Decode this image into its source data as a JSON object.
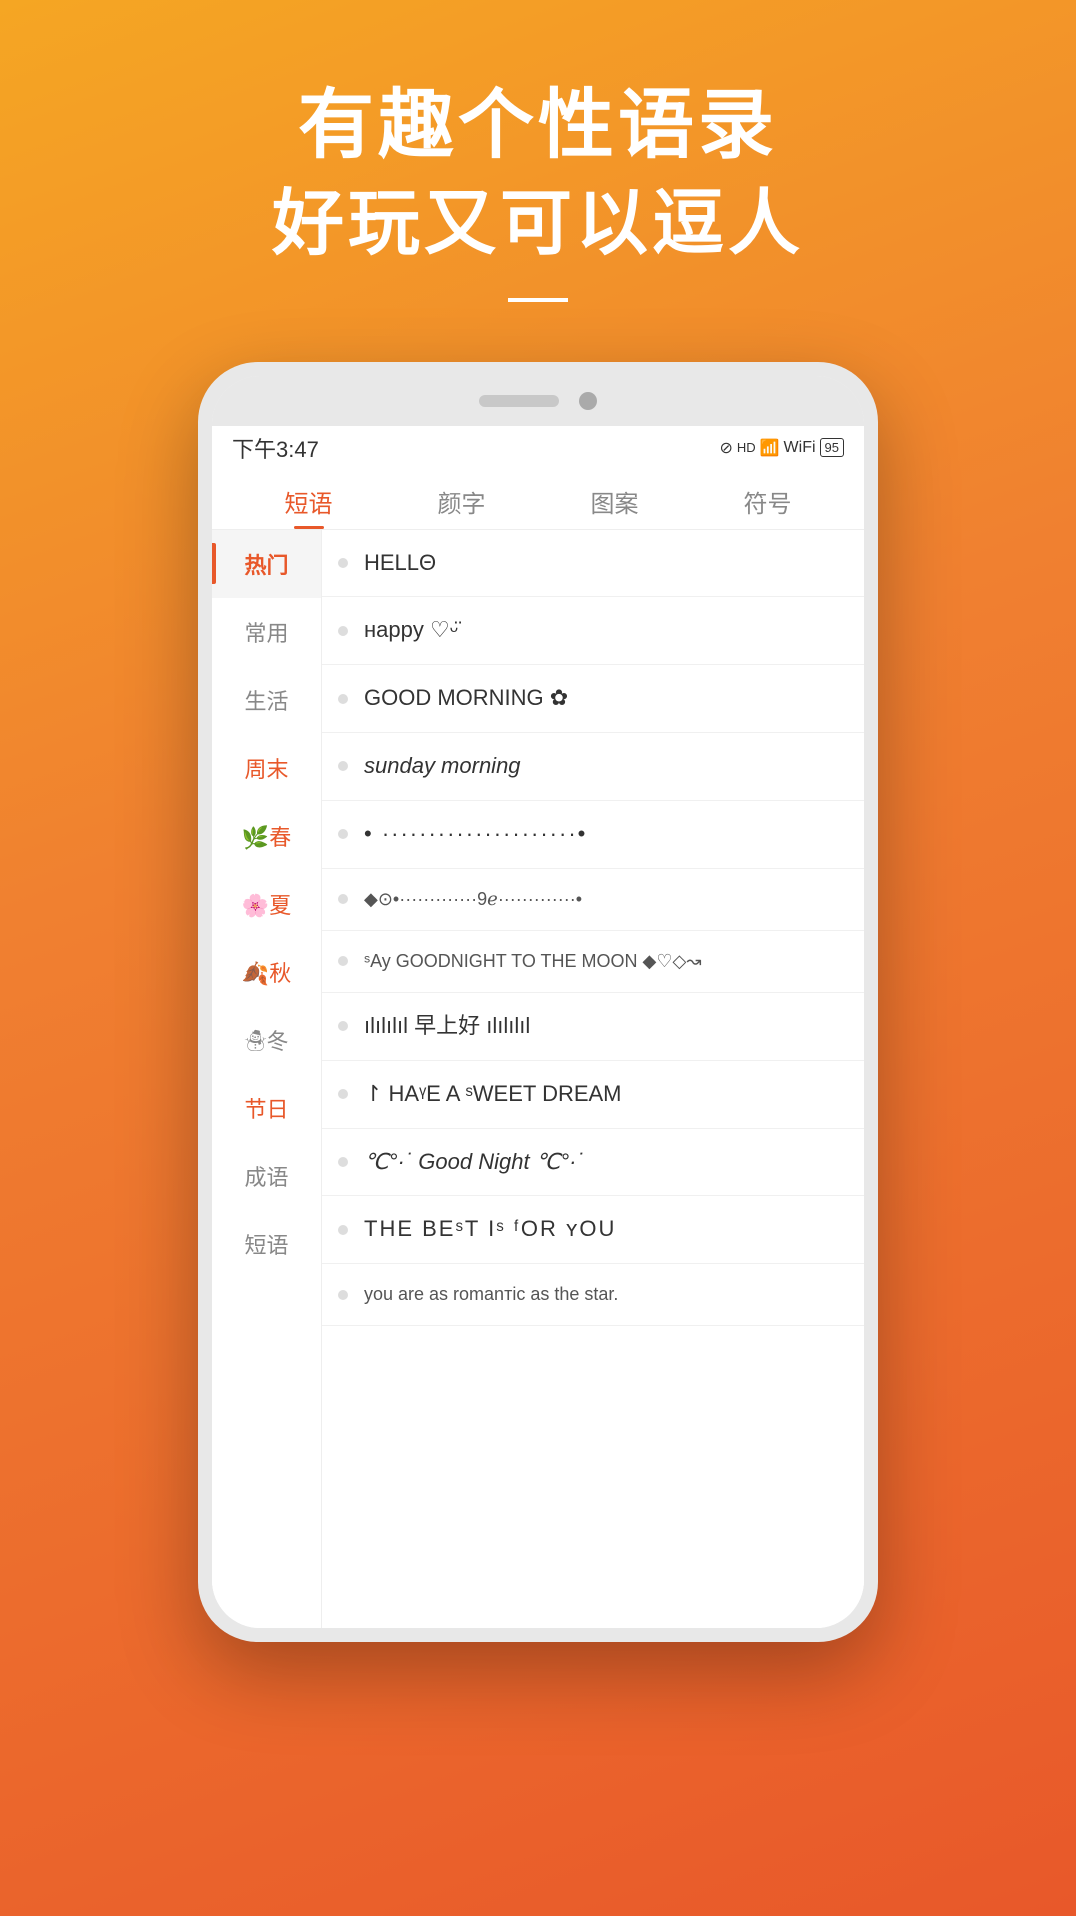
{
  "hero": {
    "line1": "有趣个性语录",
    "line2": "好玩又可以逗人"
  },
  "status_bar": {
    "time": "下午3:47",
    "battery": "95"
  },
  "tabs": [
    {
      "label": "短语",
      "active": true
    },
    {
      "label": "颜字",
      "active": false
    },
    {
      "label": "图案",
      "active": false
    },
    {
      "label": "符号",
      "active": false
    }
  ],
  "sidebar": [
    {
      "label": "热门",
      "active": true,
      "orange": true
    },
    {
      "label": "常用",
      "active": false
    },
    {
      "label": "生活",
      "active": false
    },
    {
      "label": "周末",
      "active": false,
      "orange": true
    },
    {
      "label": "🌿春",
      "active": false,
      "orange": true
    },
    {
      "label": "🌸夏",
      "active": false,
      "orange": true
    },
    {
      "label": "🍂秋",
      "active": false,
      "orange": true
    },
    {
      "label": "☃冬",
      "active": false
    },
    {
      "label": "节日",
      "active": false,
      "orange": true
    },
    {
      "label": "成语",
      "active": false
    },
    {
      "label": "短语",
      "active": false
    }
  ],
  "list_items": [
    {
      "text": "HELLΘ",
      "style": "normal"
    },
    {
      "text": "нappy ♡ᵕ̈",
      "style": "normal"
    },
    {
      "text": "GOOD MORNING ✿",
      "style": "normal"
    },
    {
      "text": "sunday morning",
      "style": "italic"
    },
    {
      "text": "• ·····················•",
      "style": "normal"
    },
    {
      "text": "◆⊙•·····················9ℯ·················•",
      "style": "small"
    },
    {
      "text": "ˢAy GOODNIGHT TO THE MOON ◆♡◇↝",
      "style": "normal"
    },
    {
      "text": "ılılılıl 早上好 ılılılıl",
      "style": "normal"
    },
    {
      "text": "↾ HAᵞE A ˢWEET DREAM",
      "style": "normal"
    },
    {
      "text": "℃°·˙ Good Night ℃°·˙",
      "style": "italic"
    },
    {
      "text": "THE BEˢT Iˢ ᶠOR ʏOU",
      "style": "normal"
    },
    {
      "text": "you are as romanтic as the star.",
      "style": "small"
    }
  ]
}
